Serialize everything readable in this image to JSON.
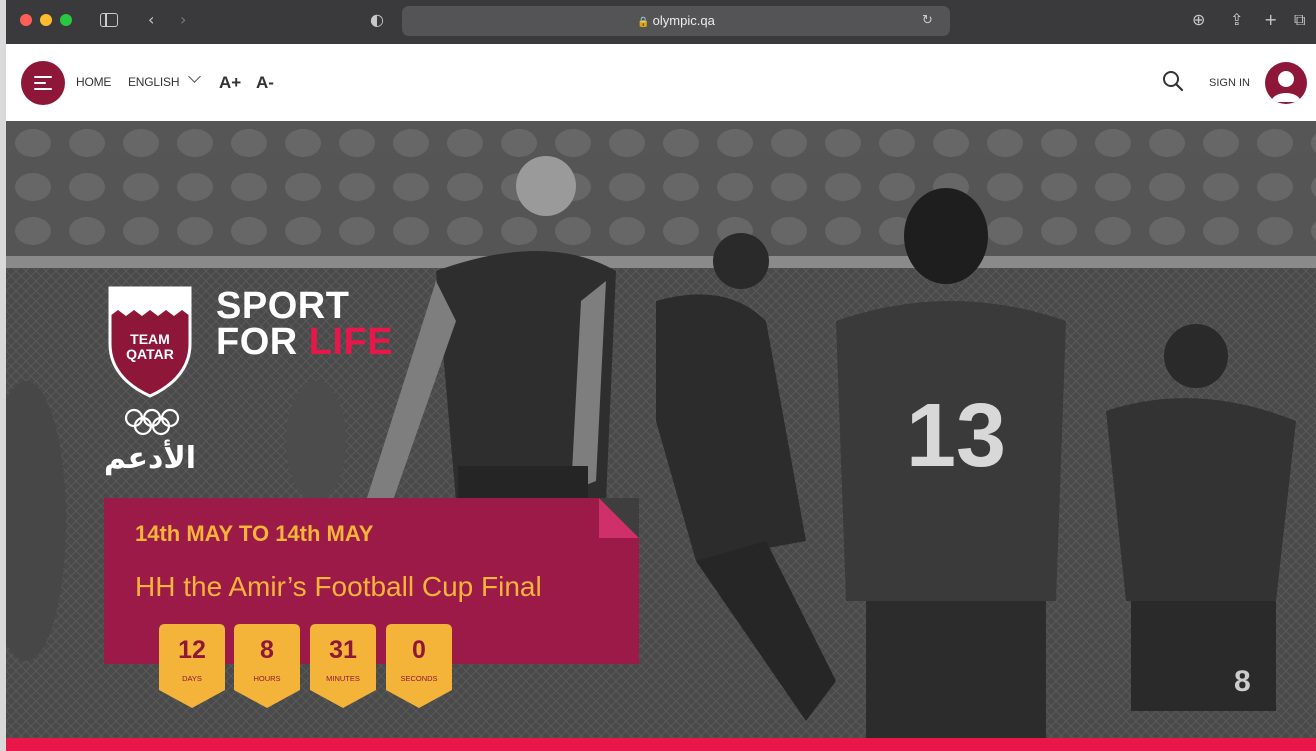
{
  "browser": {
    "url": "olympic.qa"
  },
  "header": {
    "home": "HOME",
    "language": "ENGLISH",
    "font_increase": "A+",
    "font_decrease": "A-",
    "sign_in": "SIGN IN"
  },
  "brand": {
    "team": "TEAM QATAR",
    "slogan_line1": "SPORT",
    "slogan_line2_a": "FOR ",
    "slogan_line2_b": "LIFE",
    "arabic_name": "الأدعم"
  },
  "event": {
    "date_range": "14th MAY TO 14th MAY",
    "title": "HH the Amir’s Football Cup Final",
    "countdown": [
      {
        "value": "12",
        "label": "DAYS"
      },
      {
        "value": "8",
        "label": "HOURS"
      },
      {
        "value": "31",
        "label": "MINUTES"
      },
      {
        "value": "0",
        "label": "SECONDS"
      }
    ]
  },
  "colors": {
    "maroon": "#8e1739",
    "gold": "#f4b43a",
    "accent_pink": "#e8174a"
  }
}
